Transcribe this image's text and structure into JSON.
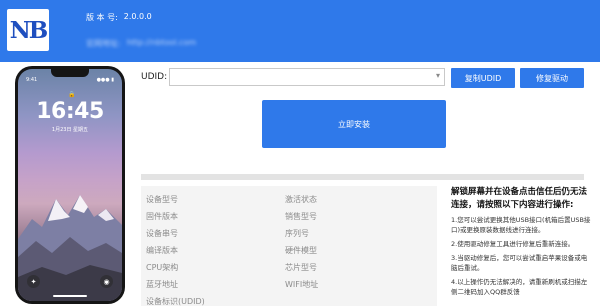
{
  "header": {
    "logo_text": "NB",
    "version_label": "版 本 号:",
    "version_value": "2.0.0.0",
    "website_label": "官网地址:",
    "website_value": "http://nbtool.com"
  },
  "phone": {
    "time": "16:45",
    "date": "1月23日 星期五",
    "status_left": "9:41",
    "status_right": "●●● ▮"
  },
  "udid": {
    "label": "UDID:",
    "value": ""
  },
  "buttons": {
    "copy_udid": "复制UDID",
    "repair_driver": "修复驱动",
    "install_now": "立即安装"
  },
  "device_info": {
    "left": [
      {
        "label": "设备型号"
      },
      {
        "label": "固件版本"
      },
      {
        "label": "设备串号"
      },
      {
        "label": "编译版本"
      },
      {
        "label": "CPU架构"
      },
      {
        "label": "蓝牙地址"
      },
      {
        "label": "设备标识(UDID)"
      }
    ],
    "right": [
      {
        "label": "激活状态"
      },
      {
        "label": "销售型号"
      },
      {
        "label": "序列号"
      },
      {
        "label": "硬件模型"
      },
      {
        "label": "芯片型号"
      },
      {
        "label": "WIFI地址"
      }
    ]
  },
  "instructions": {
    "title": "解锁屏幕并在设备点击信任后仍无法连接，请按照以下内容进行操作:",
    "steps": [
      "1.您可以尝试更换其他USB接口(机箱后置USB接口)或更换原装数据线进行连接。",
      "2.使用驱动修复工具进行修复后重新连接。",
      "3.当驱动修复后，您可以尝试重启苹果设备或电脑后重试。",
      "4.以上操作仍无法解决的，请重新刷机或扫描左侧二维码加入QQ群反馈"
    ]
  },
  "colors": {
    "accent": "#2f79ea"
  }
}
